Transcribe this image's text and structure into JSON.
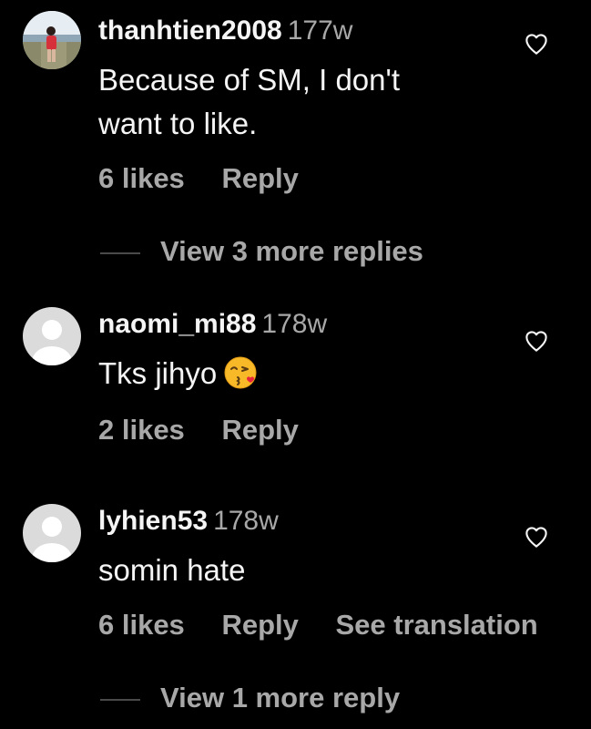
{
  "comments": [
    {
      "username": "thanhtien2008",
      "age": "177w",
      "text_lines": [
        "Because of SM, I don't",
        "want to like."
      ],
      "likes": "6 likes",
      "reply": "Reply",
      "avatar": "photo-avatar",
      "view_more": "View 3 more replies"
    },
    {
      "username": "naomi_mi88",
      "age": "178w",
      "text": "Tks jihyo",
      "emoji": "face-blowing-kiss",
      "likes": "2 likes",
      "reply": "Reply",
      "avatar": "default-avatar"
    },
    {
      "username": "lyhien53",
      "age": "178w",
      "text": "somin hate",
      "likes": "6 likes",
      "reply": "Reply",
      "translation": "See translation",
      "avatar": "default-avatar",
      "view_more": "View 1 more reply"
    }
  ],
  "colors": {
    "background": "#000000",
    "primary_text": "#f5f5f5",
    "secondary_text": "#a8a8a8",
    "divider": "#4a4a4a"
  },
  "icons": [
    "heart-icon",
    "face-blowing-kiss-emoji"
  ]
}
